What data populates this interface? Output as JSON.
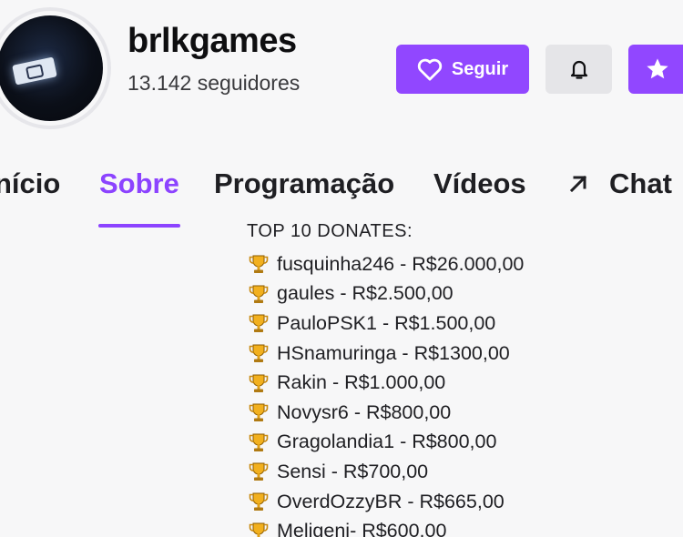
{
  "channel": {
    "name": "brlkgames",
    "followers": "13.142 seguidores"
  },
  "actions": {
    "follow_label": "Seguir"
  },
  "tabs": [
    {
      "label": "nício",
      "active": false
    },
    {
      "label": "Sobre",
      "active": true
    },
    {
      "label": "Programação",
      "active": false
    },
    {
      "label": "Vídeos",
      "active": false
    },
    {
      "label": "Chat",
      "active": false
    }
  ],
  "donates": {
    "title": "TOP 10 DONATES:",
    "items": [
      "fusquinha246 - R$26.000,00",
      "gaules - R$2.500,00",
      "PauloPSK1 - R$1.500,00",
      "HSnamuringa - R$1300,00",
      "Rakin - R$1.000,00",
      "Novysr6 - R$800,00",
      "Gragolandia1 - R$800,00",
      "Sensi - R$700,00",
      "OverdOzzyBR - R$665,00",
      "Meligeni- R$600,00"
    ]
  },
  "colors": {
    "accent": "#9147ff",
    "active_tab": "#8c43ff",
    "background": "#f7f7f8",
    "trophy": "#f2b01e"
  },
  "icons": [
    "heart-icon",
    "bell-icon",
    "star-icon",
    "arrow-up-right-icon",
    "trophy-icon"
  ]
}
